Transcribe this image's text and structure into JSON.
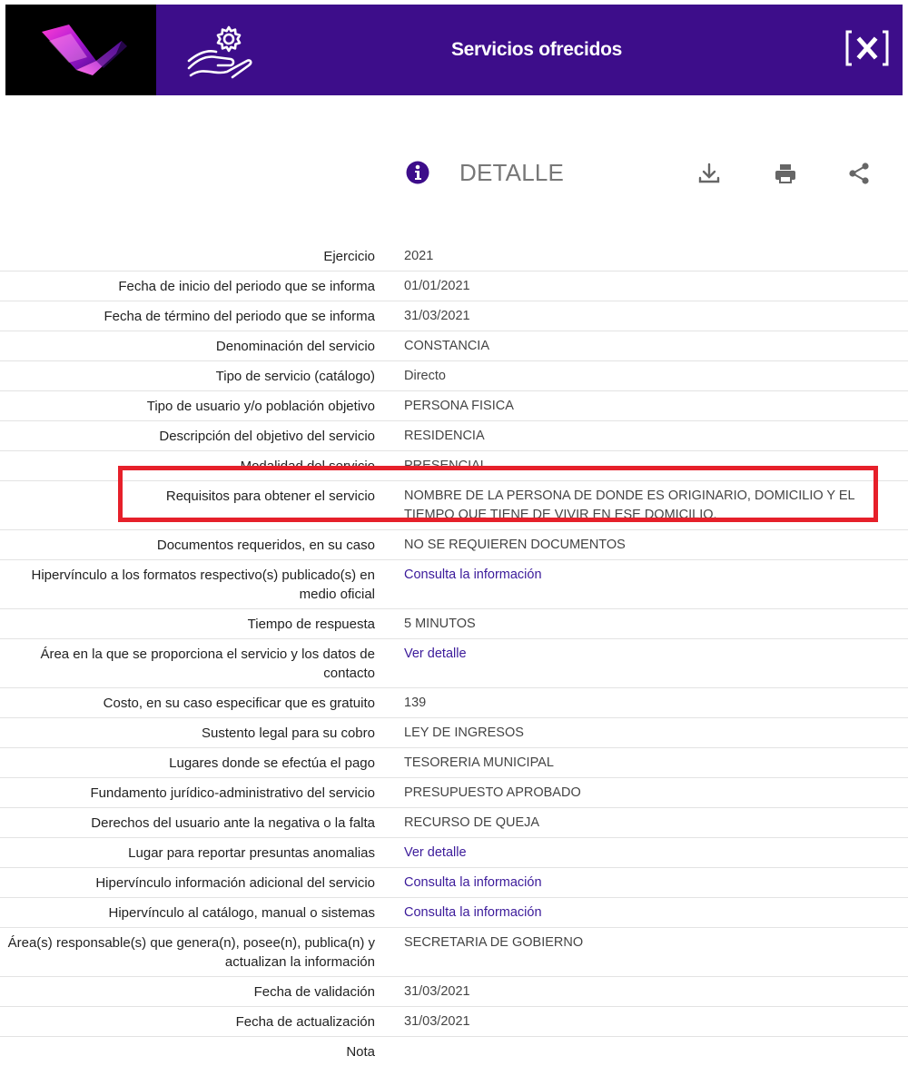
{
  "header": {
    "title": "Servicios ofrecidos",
    "close_label": "[×]"
  },
  "toolbar": {
    "detalle_label": "DETALLE"
  },
  "details": [
    {
      "label": "Ejercicio",
      "value": "2021"
    },
    {
      "label": "Fecha de inicio del periodo que se informa",
      "value": "01/01/2021"
    },
    {
      "label": "Fecha de término del periodo que se informa",
      "value": "31/03/2021"
    },
    {
      "label": "Denominación del servicio",
      "value": "CONSTANCIA"
    },
    {
      "label": "Tipo de servicio (catálogo)",
      "value": "Directo"
    },
    {
      "label": "Tipo de usuario y/o población objetivo",
      "value": "PERSONA FISICA"
    },
    {
      "label": "Descripción del objetivo del servicio",
      "value": "RESIDENCIA"
    },
    {
      "label": "Modalidad del servicio",
      "value": "PRESENCIAL"
    },
    {
      "label": "Requisitos para obtener el servicio",
      "value": "NOMBRE DE LA PERSONA DE DONDE ES ORIGINARIO, DOMICILIO Y EL TIEMPO QUE TIENE DE VIVIR EN ESE DOMICILIO."
    },
    {
      "label": "Documentos requeridos, en su caso",
      "value": "NO SE REQUIEREN DOCUMENTOS"
    },
    {
      "label": "Hipervínculo a los formatos respectivo(s) publicado(s) en medio oficial",
      "value": "Consulta la información",
      "link": true
    },
    {
      "label": "Tiempo de respuesta",
      "value": "5 MINUTOS"
    },
    {
      "label": "Área en la que se proporciona el servicio y los datos de contacto",
      "value": "Ver detalle",
      "link": true
    },
    {
      "label": "Costo, en su caso especificar que es gratuito",
      "value": "139"
    },
    {
      "label": "Sustento legal para su cobro",
      "value": "LEY DE INGRESOS"
    },
    {
      "label": "Lugares donde se efectúa el pago",
      "value": "TESORERIA MUNICIPAL"
    },
    {
      "label": "Fundamento jurídico-administrativo del servicio",
      "value": "PRESUPUESTO APROBADO"
    },
    {
      "label": "Derechos del usuario ante la negativa o la falta",
      "value": "RECURSO DE QUEJA"
    },
    {
      "label": "Lugar para reportar presuntas anomalias",
      "value": "Ver detalle",
      "link": true
    },
    {
      "label": "Hipervínculo información adicional del servicio",
      "value": "Consulta la información",
      "link": true
    },
    {
      "label": "Hipervínculo al catálogo, manual o sistemas",
      "value": "Consulta la información",
      "link": true
    },
    {
      "label": "Área(s) responsable(s) que genera(n), posee(n), publica(n) y actualizan la información",
      "value": "SECRETARIA DE GOBIERNO"
    },
    {
      "label": "Fecha de validación",
      "value": "31/03/2021"
    },
    {
      "label": "Fecha de actualización",
      "value": "31/03/2021"
    },
    {
      "label": "Nota",
      "value": ""
    }
  ],
  "colors": {
    "header_bg": "#3d0d8a",
    "link": "#3b1a9a",
    "highlight_border": "#e6202a"
  }
}
